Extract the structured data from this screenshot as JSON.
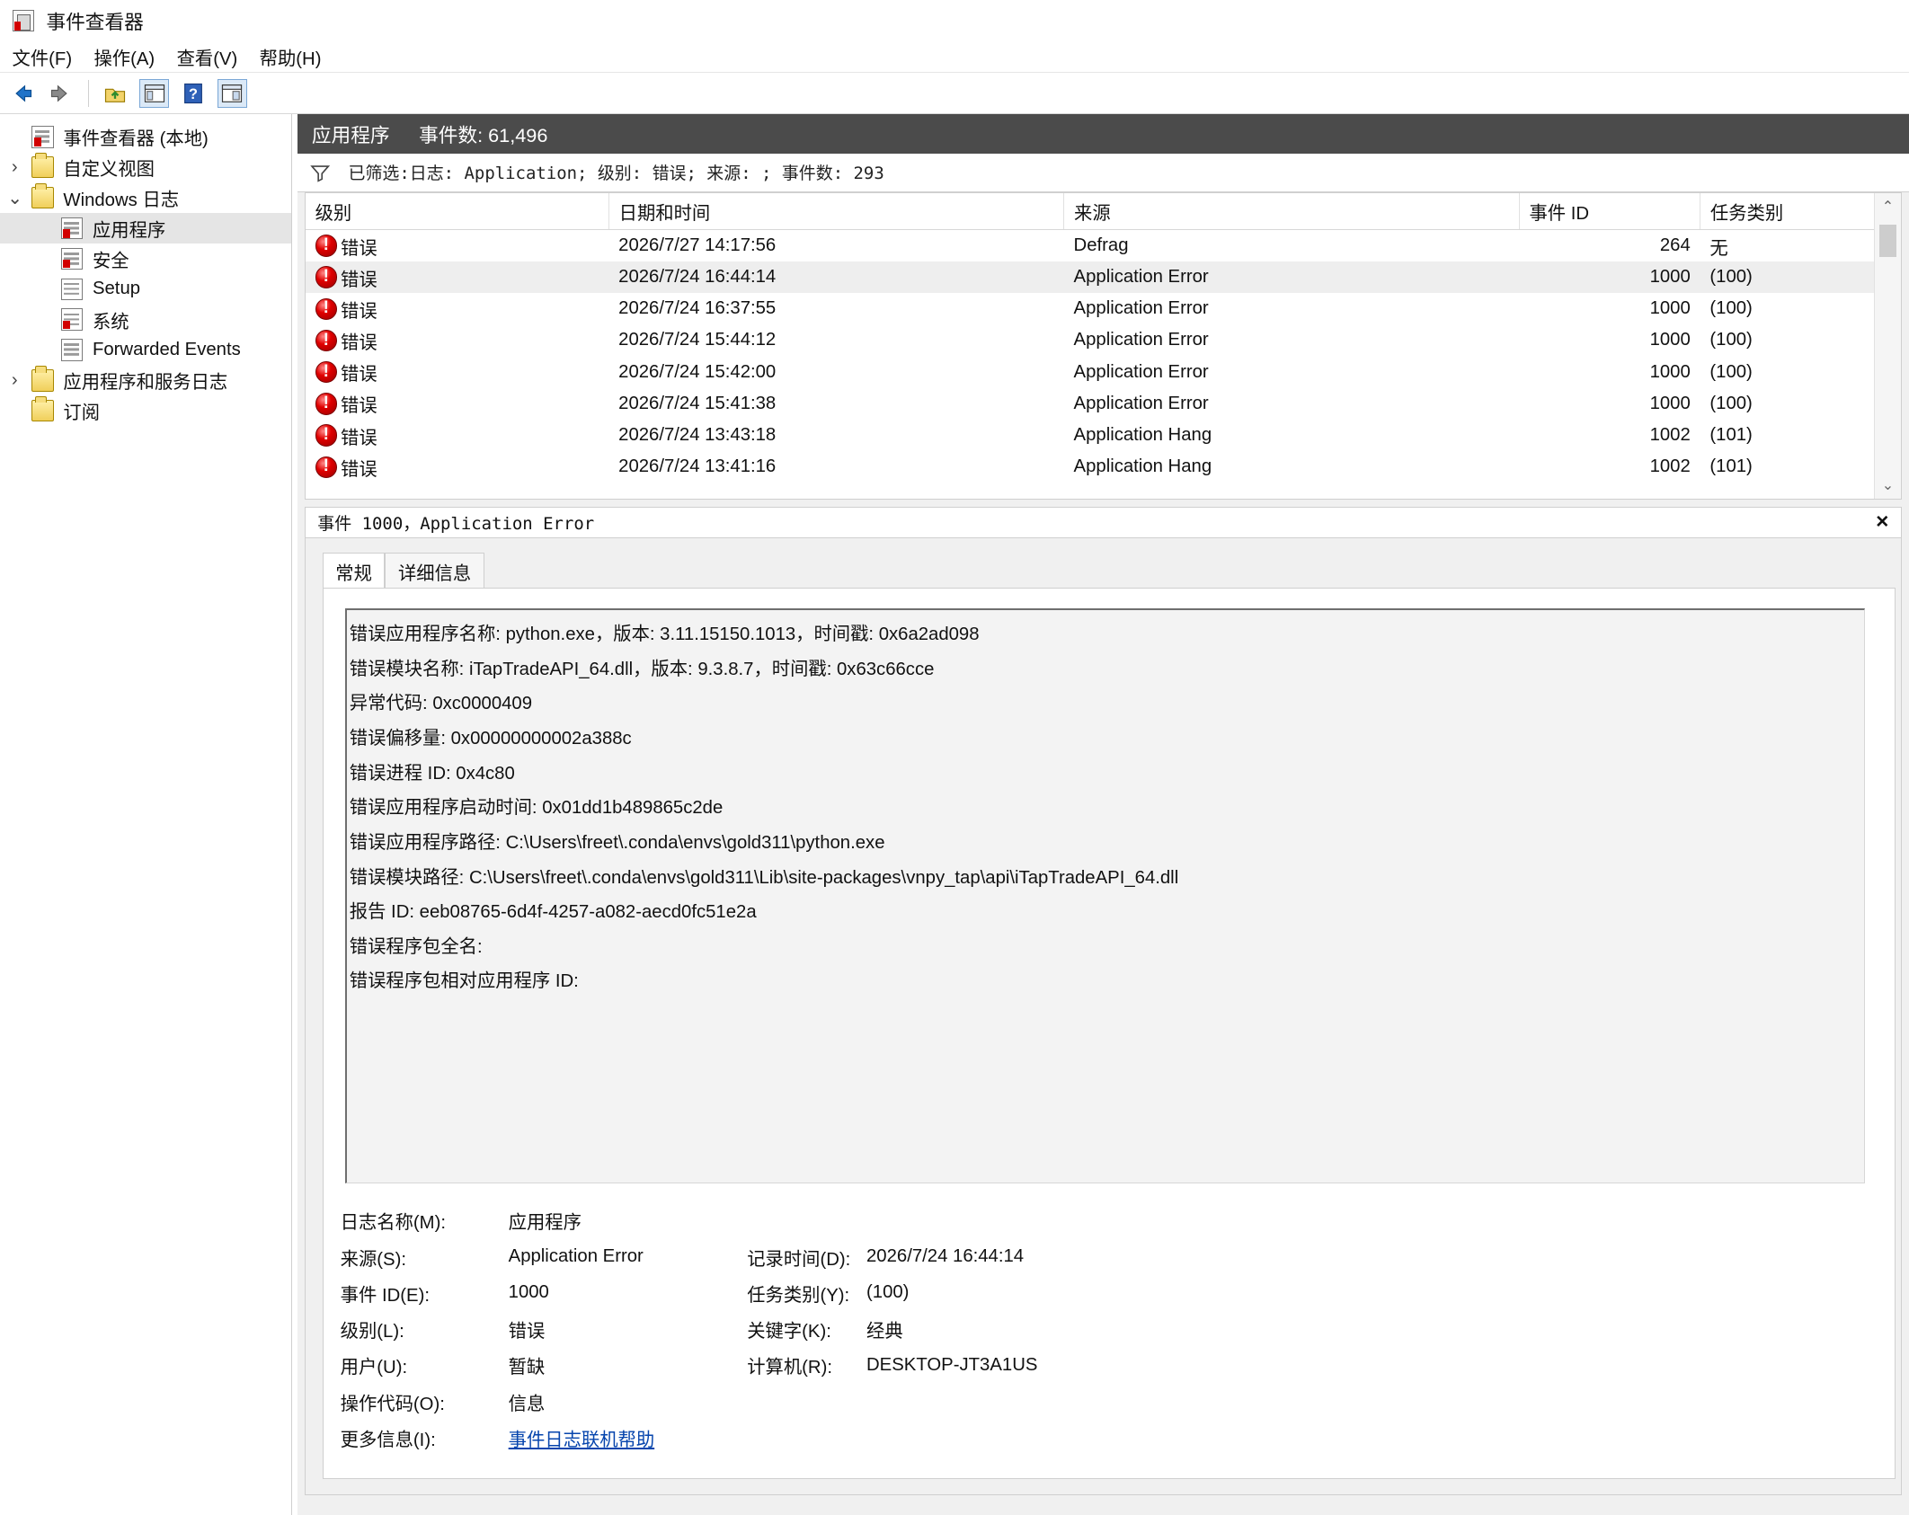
{
  "window": {
    "title": "事件查看器"
  },
  "menu": {
    "items": [
      "文件(F)",
      "操作(A)",
      "查看(V)",
      "帮助(H)"
    ]
  },
  "toolbar": {
    "icons": [
      "back-arrow-icon",
      "forward-arrow-icon",
      "up-folder-icon",
      "console-tree-icon",
      "help-icon",
      "panel-icon"
    ]
  },
  "tree": {
    "root": "事件查看器 (本地)",
    "custom_views": "自定义视图",
    "windows_logs": "Windows 日志",
    "app": "应用程序",
    "security": "安全",
    "setup": "Setup",
    "system": "系统",
    "forwarded": "Forwarded Events",
    "app_service_logs": "应用程序和服务日志",
    "subscriptions": "订阅"
  },
  "header": {
    "title": "应用程序",
    "count": "事件数: 61,496"
  },
  "filter": {
    "text": "已筛选:日志: Application; 级别: 错误; 来源: ; 事件数: 293"
  },
  "table": {
    "headers": [
      "级别",
      "日期和时间",
      "来源",
      "事件 ID",
      "任务类别"
    ],
    "rows": [
      {
        "level": "错误",
        "datetime": "2026/7/27 14:17:56",
        "source": "Defrag",
        "event_id": "264",
        "task": "无"
      },
      {
        "level": "错误",
        "datetime": "2026/7/24 16:44:14",
        "source": "Application Error",
        "event_id": "1000",
        "task": "(100)"
      },
      {
        "level": "错误",
        "datetime": "2026/7/24 16:37:55",
        "source": "Application Error",
        "event_id": "1000",
        "task": "(100)"
      },
      {
        "level": "错误",
        "datetime": "2026/7/24 15:44:12",
        "source": "Application Error",
        "event_id": "1000",
        "task": "(100)"
      },
      {
        "level": "错误",
        "datetime": "2026/7/24 15:42:00",
        "source": "Application Error",
        "event_id": "1000",
        "task": "(100)"
      },
      {
        "level": "错误",
        "datetime": "2026/7/24 15:41:38",
        "source": "Application Error",
        "event_id": "1000",
        "task": "(100)"
      },
      {
        "level": "错误",
        "datetime": "2026/7/24 13:43:18",
        "source": "Application Hang",
        "event_id": "1002",
        "task": "(101)"
      },
      {
        "level": "错误",
        "datetime": "2026/7/24 13:41:16",
        "source": "Application Hang",
        "event_id": "1002",
        "task": "(101)"
      }
    ]
  },
  "details": {
    "title": "事件 1000，Application Error",
    "tabs": [
      "常规",
      "详细信息"
    ],
    "general_lines": [
      "错误应用程序名称: python.exe，版本: 3.11.15150.1013，时间戳: 0x6a2ad098",
      "错误模块名称: iTapTradeAPI_64.dll，版本: 9.3.8.7，时间戳: 0x63c66cce",
      "异常代码: 0xc0000409",
      "错误偏移量: 0x00000000002a388c",
      "错误进程 ID: 0x4c80",
      "错误应用程序启动时间: 0x01dd1b489865c2de",
      "错误应用程序路径: C:\\Users\\freet\\.conda\\envs\\gold311\\python.exe",
      "错误模块路径: C:\\Users\\freet\\.conda\\envs\\gold311\\Lib\\site-packages\\vnpy_tap\\api\\iTapTradeAPI_64.dll",
      "报告 ID: eeb08765-6d4f-4257-a082-aecd0fc51e2a",
      "错误程序包全名:",
      "错误程序包相对应用程序 ID:"
    ],
    "fields": {
      "log_name_label": "日志名称(M):",
      "log_name_value": "应用程序",
      "source_label": "来源(S):",
      "source_value": "Application Error",
      "logged_label": "记录时间(D):",
      "logged_value": "2026/7/24 16:44:14",
      "event_id_label": "事件 ID(E):",
      "event_id_value": "1000",
      "task_label": "任务类别(Y):",
      "task_value": "(100)",
      "level_label": "级别(L):",
      "level_value": "错误",
      "keywords_label": "关键字(K):",
      "keywords_value": "经典",
      "user_label": "用户(U):",
      "user_value": "暂缺",
      "computer_label": "计算机(R):",
      "computer_value": "DESKTOP-JT3A1US",
      "opcode_label": "操作代码(O):",
      "opcode_value": "信息",
      "more_info_label": "更多信息(I):",
      "more_info_link": "事件日志联机帮助"
    }
  }
}
